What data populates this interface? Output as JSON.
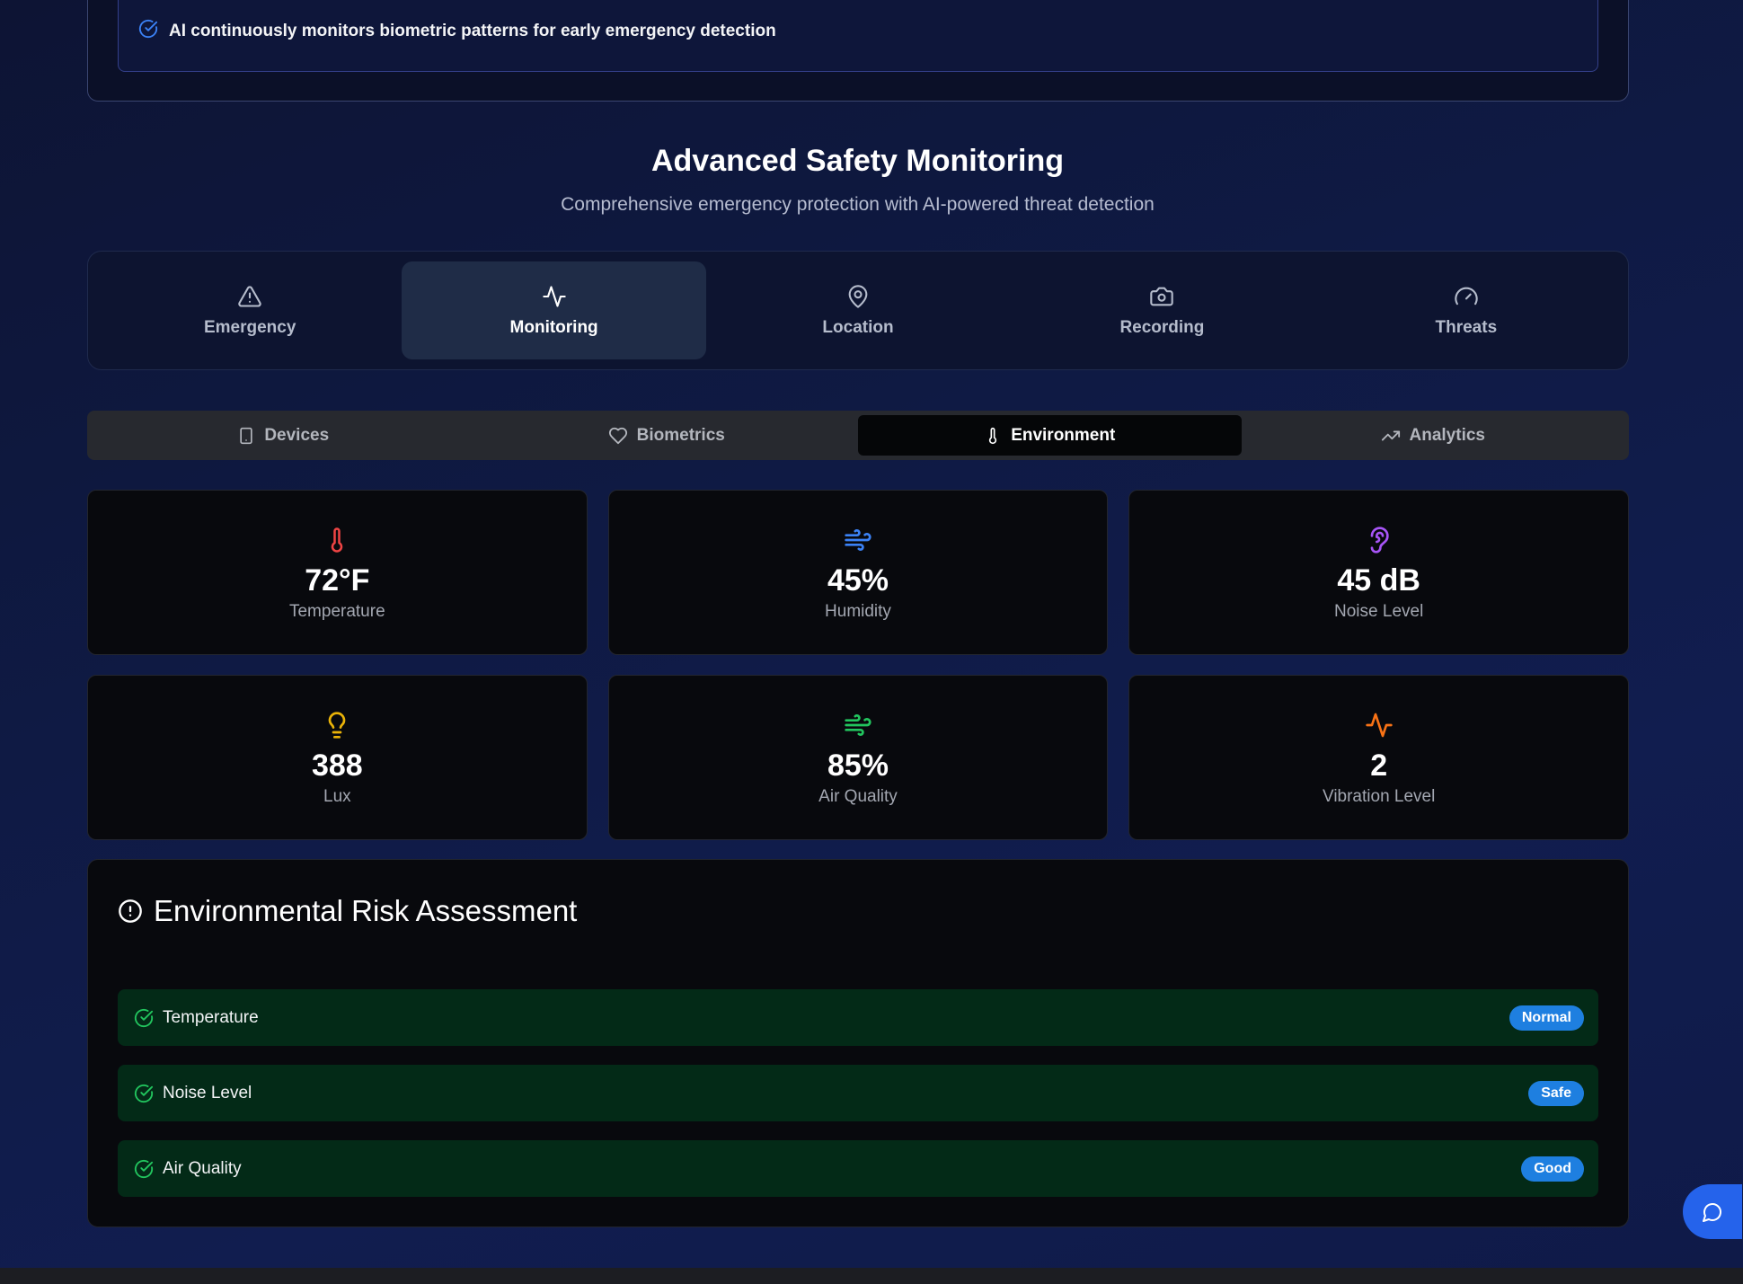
{
  "top_notice": {
    "text": "AI continuously monitors biometric patterns for early emergency detection"
  },
  "header": {
    "title": "Advanced Safety Monitoring",
    "subtitle": "Comprehensive emergency protection with AI-powered threat detection"
  },
  "main_tabs": [
    {
      "label": "Emergency",
      "icon": "alert-triangle-icon",
      "active": false
    },
    {
      "label": "Monitoring",
      "icon": "activity-icon",
      "active": true
    },
    {
      "label": "Location",
      "icon": "map-pin-icon",
      "active": false
    },
    {
      "label": "Recording",
      "icon": "camera-icon",
      "active": false
    },
    {
      "label": "Threats",
      "icon": "gauge-icon",
      "active": false
    }
  ],
  "sub_tabs": [
    {
      "label": "Devices",
      "icon": "smartphone-icon",
      "active": false
    },
    {
      "label": "Biometrics",
      "icon": "heart-icon",
      "active": false
    },
    {
      "label": "Environment",
      "icon": "thermometer-icon",
      "active": true
    },
    {
      "label": "Analytics",
      "icon": "trending-up-icon",
      "active": false
    }
  ],
  "metrics": [
    {
      "value": "72°F",
      "label": "Temperature",
      "icon": "thermometer-icon",
      "color": "#ef4444"
    },
    {
      "value": "45%",
      "label": "Humidity",
      "icon": "wind-icon",
      "color": "#3b82f6"
    },
    {
      "value": "45 dB",
      "label": "Noise Level",
      "icon": "ear-icon",
      "color": "#a855f7"
    },
    {
      "value": "388",
      "label": "Lux",
      "icon": "lightbulb-icon",
      "color": "#eab308"
    },
    {
      "value": "85%",
      "label": "Air Quality",
      "icon": "wind-icon",
      "color": "#22c55e"
    },
    {
      "value": "2",
      "label": "Vibration Level",
      "icon": "activity-icon",
      "color": "#f97316"
    }
  ],
  "risk": {
    "title": "Environmental Risk Assessment",
    "items": [
      {
        "name": "Temperature",
        "status": "Normal"
      },
      {
        "name": "Noise Level",
        "status": "Safe"
      },
      {
        "name": "Air Quality",
        "status": "Good"
      }
    ]
  },
  "colors": {
    "accent": "#2563eb",
    "badge": "#1e7fe0",
    "risk_row_bg": "#032a17",
    "check": "#22c55e"
  }
}
